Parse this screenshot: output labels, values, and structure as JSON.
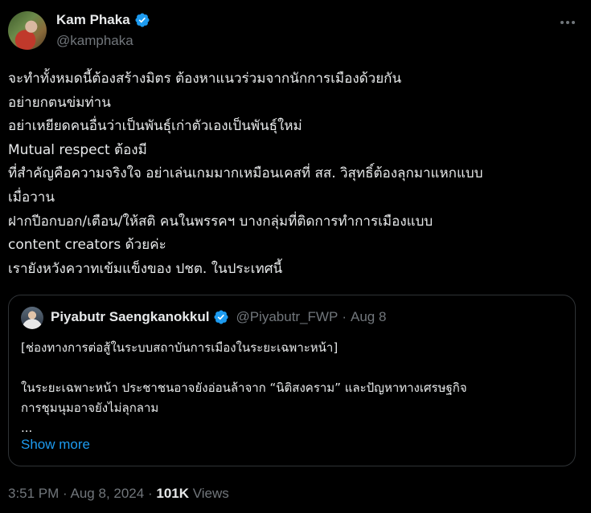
{
  "author": {
    "display_name": "Kam Phaka",
    "handle": "@kamphaka",
    "verified_icon": "verified-badge-icon"
  },
  "more_icon": "more-options-icon",
  "tweet": {
    "lines": [
      "จะทำทั้งหมดนี้ต้องสร้างมิตร ต้องหาแนวร่วมจากนักการเมืองด้วยกัน",
      "อย่ายกตนข่มท่าน",
      "อย่าเหยียดคนอื่นว่าเป็นพันธุ์เก่าตัวเองเป็นพันธุ์ใหม่",
      "Mutual respect ต้องมี",
      "ที่สำคัญคือความจริงใจ อย่าเล่นเกมมากเหมือนเคสที่ สส. วิสุทธิ์ต้องลุกมาแหกแบบ",
      "เมื่อวาน",
      "ฝากปีอกบอก/เตือน/ให้สติ คนในพรรคฯ บางกลุ่มที่ติดการทำการเมืองแบบ",
      "content creators ด้วยค่ะ",
      "เรายังหวังควาทเข้มแข็งของ ปชต. ในประเทศนี้"
    ]
  },
  "quote": {
    "display_name": "Piyabutr Saengkanokkul",
    "handle": "@Piyabutr_FWP",
    "separator": "·",
    "date": "Aug 8",
    "lines": [
      "[ช่องทางการต่อสู้ในระบบสถาบันการเมืองในระยะเฉพาะหน้า]",
      "",
      "ในระยะเฉพาะหน้า ประชาชนอาจยังอ่อนล้าจาก “นิติสงคราม” และปัญหาทางเศรษฐกิจ",
      "การชุมนุมอาจยังไม่ลุกลาม",
      "..."
    ],
    "show_more": "Show more"
  },
  "meta": {
    "time": "3:51 PM",
    "separator": "·",
    "date": "Aug 8, 2024",
    "views_count": "101K",
    "views_label": "Views"
  },
  "colors": {
    "background": "#000000",
    "text": "#e7e9ea",
    "muted": "#71767b",
    "accent": "#1d9bf0",
    "border": "#2f3336"
  }
}
